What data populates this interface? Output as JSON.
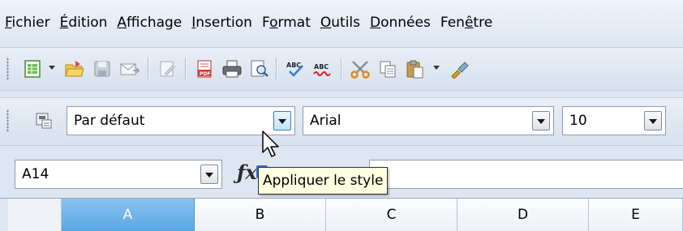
{
  "menu": [
    {
      "mnemonic": "F",
      "rest": "ichier"
    },
    {
      "mnemonic": "É",
      "rest": "dition"
    },
    {
      "mnemonic": "A",
      "rest": "ffichage"
    },
    {
      "mnemonic": "I",
      "rest": "nsertion"
    },
    {
      "pre": "F",
      "mnemonic": "o",
      "rest": "rmat"
    },
    {
      "mnemonic": "O",
      "rest": "utils"
    },
    {
      "mnemonic": "D",
      "rest": "onnées"
    },
    {
      "pre": "Fen",
      "mnemonic": "ê",
      "rest": "tre"
    }
  ],
  "toolbar": {
    "icons": [
      "new-document-icon",
      "open-folder-icon",
      "save-icon",
      "email-icon",
      "edit-file-icon",
      "export-pdf-icon",
      "print-icon",
      "print-preview-icon",
      "spellcheck-icon",
      "autospellcheck-icon",
      "cut-icon",
      "copy-icon",
      "paste-icon",
      "clone-formatting-icon"
    ]
  },
  "format": {
    "style_value": "Par défaut",
    "font_value": "Arial",
    "size_value": "10"
  },
  "formula": {
    "cell_ref": "A14",
    "fx_label": "ƒx"
  },
  "tooltip": "Appliquer le style",
  "columns": [
    "A",
    "B",
    "C",
    "D",
    "E"
  ],
  "selected_column": "A",
  "colors": {
    "background": "#dde6f1",
    "selected_header": "#5aa7e4",
    "tooltip_bg": "#ffffe1"
  }
}
